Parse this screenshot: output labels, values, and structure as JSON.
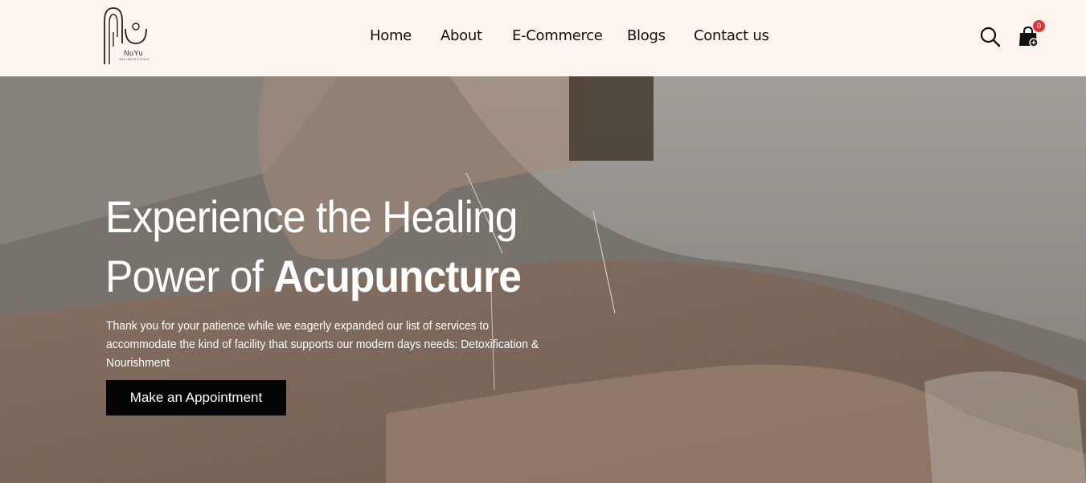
{
  "brand": {
    "name": "NuYu",
    "tagline": "WELLNESS STUDIO"
  },
  "nav": {
    "items": [
      "Home",
      "About",
      "E-Commerce",
      "Blogs",
      "Contact us"
    ]
  },
  "header_icons": {
    "search": "search-icon",
    "cart": "shopping-bag-icon",
    "cart_count": "0"
  },
  "hero": {
    "title_line1": "Experience the Healing",
    "title_line2_normal": "Power of ",
    "title_line2_bold": "Acupuncture",
    "description": "Thank you for your patience while we eagerly expanded our list of services to accommodate the kind of facility that supports our modern days needs: Detoxification & Nourishment",
    "cta_label": "Make an Appointment"
  },
  "colors": {
    "header_bg": "#fdf4ee",
    "cta_bg": "#050505",
    "badge": "#e8303c"
  }
}
